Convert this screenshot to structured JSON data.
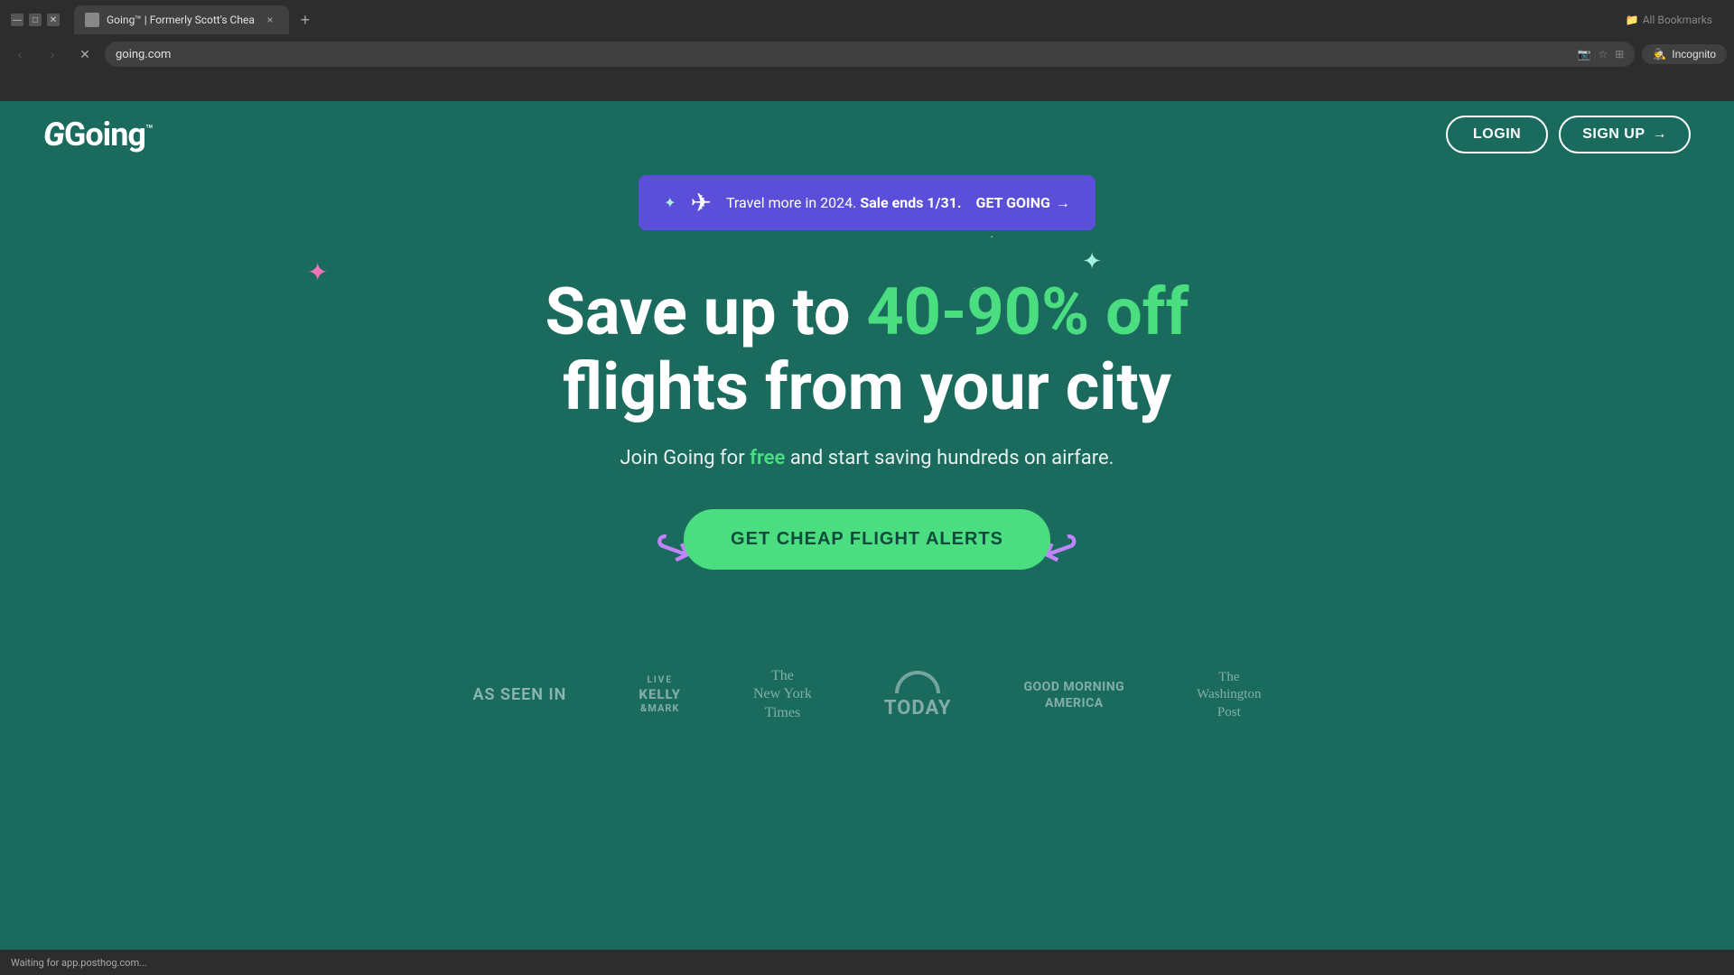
{
  "browser": {
    "tab_title": "Going™ | Formerly Scott's Chea",
    "url": "going.com",
    "new_tab_label": "+",
    "close_tab_label": "×",
    "incognito_label": "Incognito",
    "bookmarks_label": "All Bookmarks",
    "nav": {
      "back": "‹",
      "forward": "›",
      "reload": "✕"
    }
  },
  "nav": {
    "logo_text": "Going",
    "logo_tm": "™",
    "login_label": "LOGIN",
    "signup_label": "SIGN UP",
    "signup_arrow": "→"
  },
  "promo": {
    "text_normal": "Travel more in 2024.",
    "text_bold": " Sale ends 1/31.",
    "cta_label": "GET GOING",
    "cta_arrow": "→",
    "sparkle": "✦"
  },
  "hero": {
    "title_part1": "Save up to ",
    "title_highlight": "40-90% off",
    "title_part2": "flights from your city",
    "subtitle_part1": "Join Going for ",
    "subtitle_free": "free",
    "subtitle_part2": " and start saving hundreds on airfare.",
    "cta_label": "GET CHEAP FLIGHT ALERTS",
    "arrow_left": "↩",
    "arrow_right": "↪"
  },
  "as_seen_in": {
    "label": "AS SEEN IN",
    "outlets": [
      {
        "name": "Live Kelly and Mark",
        "display": "LIVE\nKELLY\n&MARK",
        "style": "kelly-mark"
      },
      {
        "name": "The New York Times",
        "display": "The\nNew York\nTimes",
        "style": "nyt"
      },
      {
        "name": "TODAY",
        "display": "TODAY",
        "style": "today"
      },
      {
        "name": "Good Morning America",
        "display": "GOOD MORNING\nAMERICA",
        "style": "gma"
      },
      {
        "name": "The Washington Post",
        "display": "The\nWashington\nPost",
        "style": "wapo"
      }
    ]
  },
  "status_bar": {
    "text": "Waiting for app.posthog.com..."
  },
  "decorations": {
    "sparkles": [
      "✦",
      "·",
      "✦",
      "✦",
      "·",
      "✦"
    ]
  }
}
